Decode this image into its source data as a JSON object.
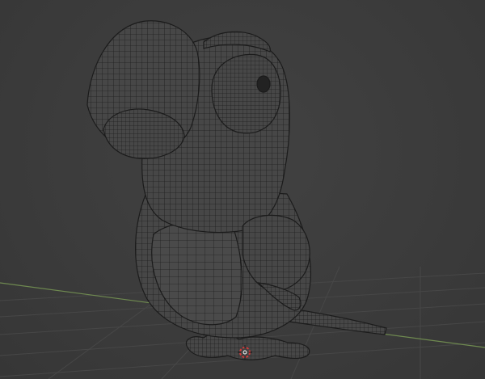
{
  "viewport": {
    "mode": "wireframe",
    "subject": "parrot-model"
  },
  "colors": {
    "background": "#3d3d3d",
    "grid_line": "#4a4a4a",
    "x_axis": "#7a8e5a",
    "mesh_fill": "#484848",
    "mesh_wire": "#1c1c1c",
    "cursor_outer": "#d23b3b",
    "cursor_inner": "#ffffff"
  },
  "icons": {
    "cursor": "3d-cursor-icon"
  }
}
